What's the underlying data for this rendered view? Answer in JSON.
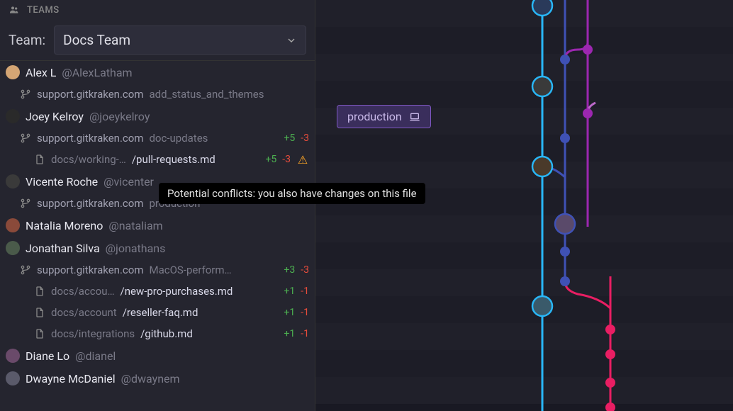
{
  "sidebar": {
    "header": "TEAMS",
    "team_label": "Team:",
    "selected_team": "Docs Team",
    "members": [
      {
        "name": "Alex L",
        "handle": "@AlexLatham",
        "avatar_bg": "#d4a574",
        "repos": [
          {
            "name": "support.gitkraken.com",
            "branch": "add_status_and_themes"
          }
        ]
      },
      {
        "name": "Joey Kelroy",
        "handle": "@joeykelroy",
        "avatar_bg": "#2a2a2a",
        "repos": [
          {
            "name": "support.gitkraken.com",
            "branch": "doc-updates",
            "adds": "+5",
            "dels": "-3",
            "files": [
              {
                "path": "docs/working-…",
                "highlight": "/pull-requests.md",
                "adds": "+5",
                "dels": "-3",
                "warning": true
              }
            ]
          }
        ]
      },
      {
        "name": "Vicente Roche",
        "handle": "@vicenter",
        "avatar_bg": "#3a3a3a",
        "repos": [
          {
            "name": "support.gitkraken.com",
            "branch": "production"
          }
        ]
      },
      {
        "name": "Natalia Moreno",
        "handle": "@nataliam",
        "avatar_bg": "#8a4a3a"
      },
      {
        "name": "Jonathan Silva",
        "handle": "@jonathans",
        "avatar_bg": "#4a5a4a",
        "repos": [
          {
            "name": "support.gitkraken.com",
            "branch": "MacOS-perform…",
            "adds": "+3",
            "dels": "-3",
            "files": [
              {
                "path": "docs/accou…",
                "highlight": "/new-pro-purchases.md",
                "adds": "+1",
                "dels": "-1"
              },
              {
                "path": "docs/account",
                "highlight": "/reseller-faq.md",
                "adds": "+1",
                "dels": "-1"
              },
              {
                "path": "docs/integrations",
                "highlight": "/github.md",
                "adds": "+1",
                "dels": "-1"
              }
            ]
          }
        ]
      },
      {
        "name": "Diane Lo",
        "handle": "@dianel",
        "avatar_bg": "#6a4a6a"
      },
      {
        "name": "Dwayne McDaniel",
        "handle": "@dwaynem",
        "avatar_bg": "#5a5a6a"
      }
    ]
  },
  "tooltip": "Potential conflicts: you also have changes on this file",
  "graph": {
    "branch_label": "production",
    "colors": {
      "cyan": "#29b6f6",
      "blue": "#3f51b5",
      "purple": "#9c27b0",
      "pink": "#e91e63",
      "magenta": "#ba68c8"
    }
  }
}
